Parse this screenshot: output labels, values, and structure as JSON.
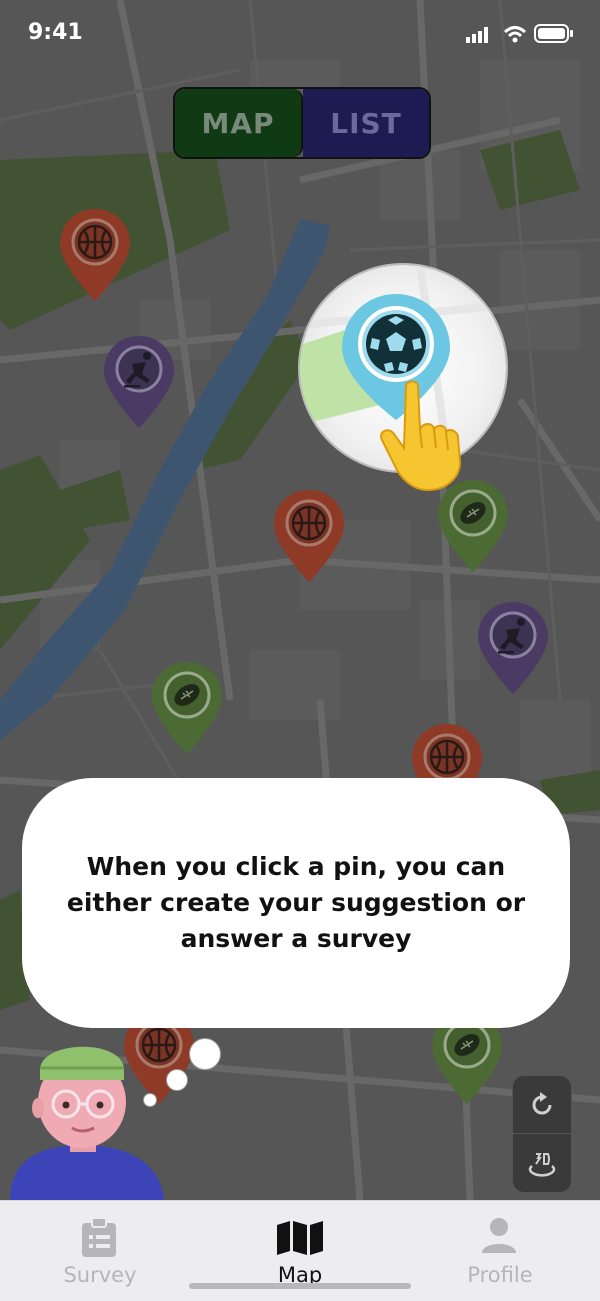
{
  "status_bar": {
    "time": "9:41"
  },
  "view_toggle": {
    "map_label": "MAP",
    "list_label": "LIST",
    "selected": "MAP"
  },
  "pins": [
    {
      "sport": "basketball-icon",
      "color": "#b0341e"
    },
    {
      "sport": "skating-icon",
      "color": "#5a3b84"
    },
    {
      "sport": "soccer-icon",
      "color": "#5bc7e3"
    },
    {
      "sport": "basketball-icon",
      "color": "#b0341e"
    },
    {
      "sport": "football-icon",
      "color": "#4e8a2a"
    },
    {
      "sport": "skating-icon",
      "color": "#5a3b84"
    },
    {
      "sport": "football-icon",
      "color": "#4e8a2a"
    },
    {
      "sport": "basketball-icon",
      "color": "#b0341e"
    },
    {
      "sport": "basketball-icon",
      "color": "#b0341e"
    },
    {
      "sport": "football-icon",
      "color": "#4e8a2a"
    }
  ],
  "tooltip": {
    "text": "When you click a pin, you can either create your suggestion or answer a survey"
  },
  "tab_bar": {
    "tabs": [
      {
        "label": "Survey",
        "icon": "clipboard-icon",
        "active": false
      },
      {
        "label": "Map",
        "icon": "map-icon",
        "active": true
      },
      {
        "label": "Profile",
        "icon": "person-icon",
        "active": false
      }
    ]
  },
  "colors": {
    "map_toggle_bg": "#0f3a14",
    "list_toggle_bg": "#1c1c52",
    "park_green": "#4f6b3a",
    "river_blue": "#4a6e96"
  }
}
